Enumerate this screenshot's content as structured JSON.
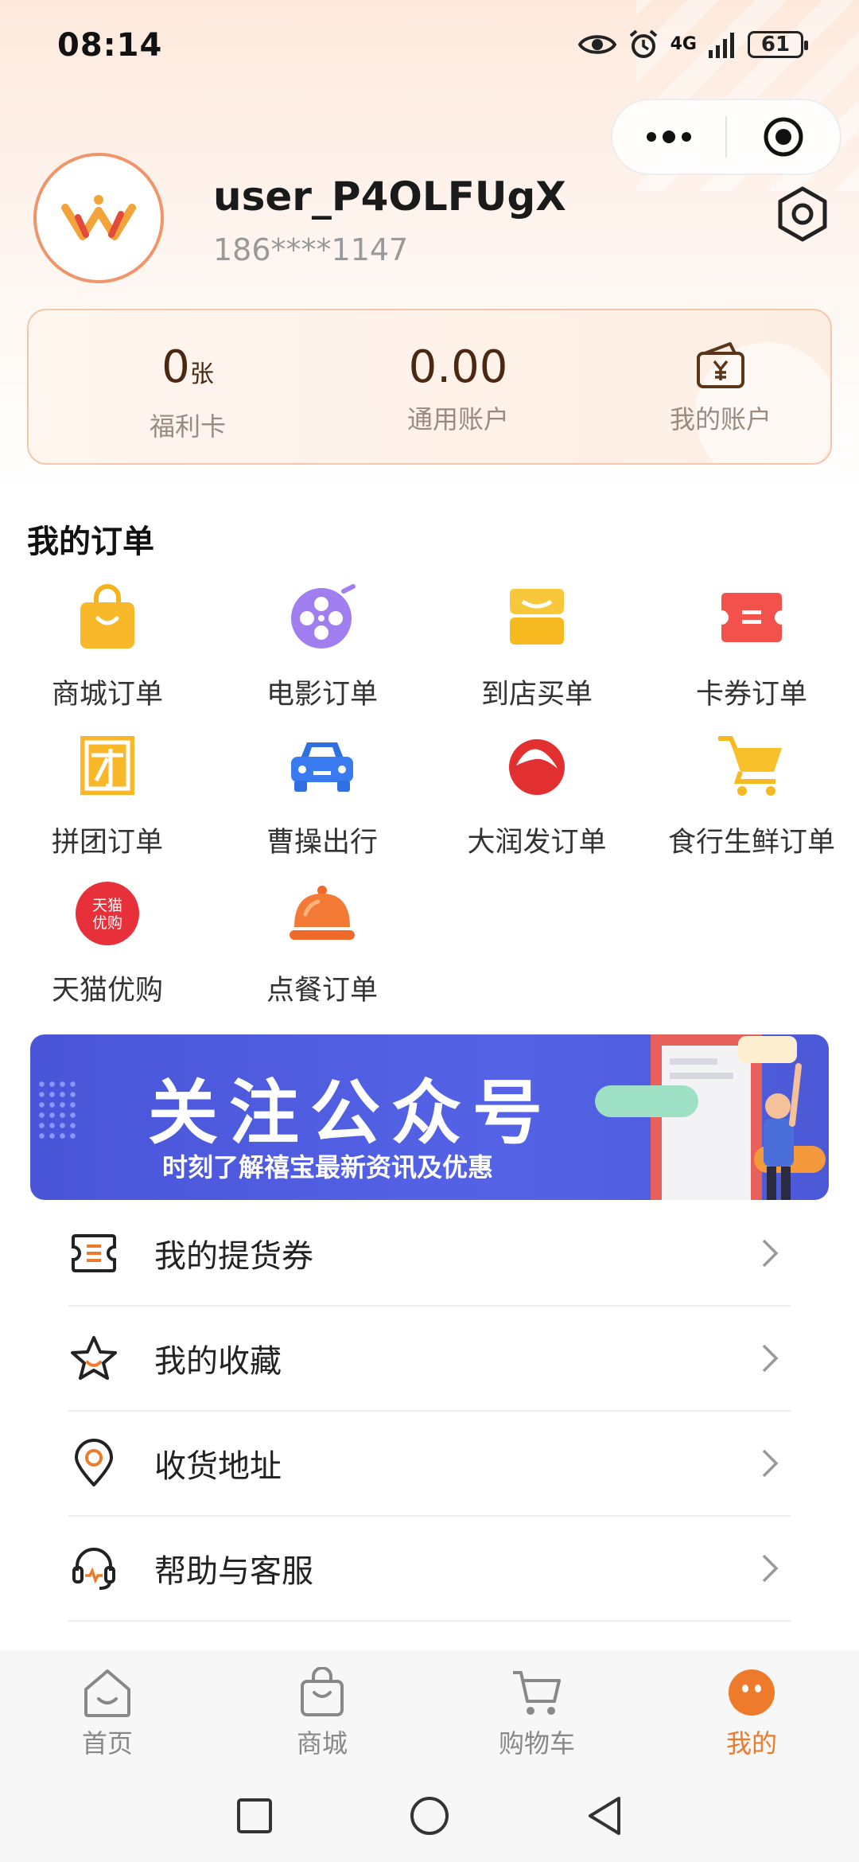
{
  "status_bar": {
    "time": "08:14",
    "network": "4G",
    "battery": "61"
  },
  "profile": {
    "username": "user_P4OLFUgX",
    "phone": "186****1147"
  },
  "account": {
    "welfare_card_value": "0",
    "welfare_card_unit": "张",
    "welfare_card_label": "福利卡",
    "general_balance": "0.00",
    "general_label": "通用账户",
    "my_account_label": "我的账户"
  },
  "orders": {
    "title": "我的订单",
    "items": [
      {
        "label": "商城订单",
        "icon": "shopping-bag-icon"
      },
      {
        "label": "电影订单",
        "icon": "film-reel-icon"
      },
      {
        "label": "到店买单",
        "icon": "store-icon"
      },
      {
        "label": "卡券订单",
        "icon": "ticket-icon"
      },
      {
        "label": "拼团订单",
        "icon": "group-buy-icon"
      },
      {
        "label": "曹操出行",
        "icon": "car-icon"
      },
      {
        "label": "大润发订单",
        "icon": "rt-mart-icon"
      },
      {
        "label": "食行生鲜订单",
        "icon": "cart-icon"
      },
      {
        "label": "天猫优购",
        "icon": "tmall-icon"
      },
      {
        "label": "点餐订单",
        "icon": "food-cloche-icon"
      }
    ],
    "tmall_icon_text": "天猫优购"
  },
  "banner": {
    "title": "关注公众号",
    "subtitle": "时刻了解禧宝最新资讯及优惠"
  },
  "menu": [
    {
      "label": "我的提货券",
      "icon": "voucher-icon"
    },
    {
      "label": "我的收藏",
      "icon": "star-icon"
    },
    {
      "label": "收货地址",
      "icon": "location-pin-icon"
    },
    {
      "label": "帮助与客服",
      "icon": "headset-icon"
    }
  ],
  "tabs": [
    {
      "label": "首页",
      "icon": "home-icon"
    },
    {
      "label": "商城",
      "icon": "bag-icon"
    },
    {
      "label": "购物车",
      "icon": "cart-icon"
    },
    {
      "label": "我的",
      "icon": "profile-face-icon",
      "active": true
    }
  ],
  "colors": {
    "accent": "#ee7a2c",
    "banner": "#4a55d8"
  }
}
